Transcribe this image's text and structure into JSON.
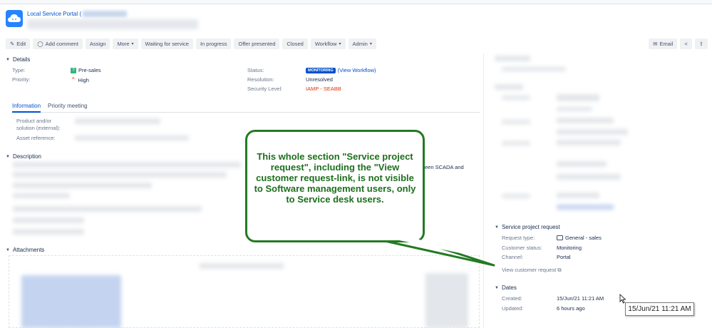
{
  "header": {
    "breadcrumb": "Local Service Portal ("
  },
  "toolbar": {
    "edit": "Edit",
    "add_comment": "Add comment",
    "assign": "Assign",
    "more": "More",
    "waiting": "Waiting for service",
    "in_progress": "In progress",
    "offer_presented": "Offer presented",
    "closed": "Closed",
    "workflow": "Workflow",
    "admin": "Admin",
    "email": "Email"
  },
  "details": {
    "heading": "Details",
    "type_label": "Type:",
    "type_value": "Pre-sales",
    "priority_label": "Priority:",
    "priority_value": "High",
    "status_label": "Status:",
    "status_value": "MONITORING",
    "view_workflow": "(View Workflow)",
    "resolution_label": "Resolution:",
    "resolution_value": "Unresolved",
    "security_label": "Security Level:",
    "security_value": "IAMP - SEABB"
  },
  "tabs": {
    "information": "Information",
    "priority_meeting": "Priority meeting"
  },
  "info": {
    "product_label_1": "Product and/or",
    "product_label_2": "solution (external):",
    "asset_label": "Asset reference:"
  },
  "description": {
    "heading": "Description",
    "visible_fragment": "een SCADA and"
  },
  "attachments": {
    "heading": "Attachments"
  },
  "service_request": {
    "heading": "Service project request",
    "request_type_label": "Request type:",
    "request_type_value": "General - sales",
    "customer_status_label": "Customer status:",
    "customer_status_value": "Monitoring",
    "channel_label": "Channel:",
    "channel_value": "Portal",
    "view_link": "View customer request"
  },
  "dates": {
    "heading": "Dates",
    "created_label": "Created:",
    "created_value": "15/Jun/21 11:21 AM",
    "updated_label": "Updated:",
    "updated_value": "6 hours ago",
    "tooltip": "15/Jun/21 11:21 AM"
  },
  "callout": {
    "text": "This whole section \"Service project request\", including the \"View customer request-link, is not visible to Software management users, only to Service desk users."
  }
}
